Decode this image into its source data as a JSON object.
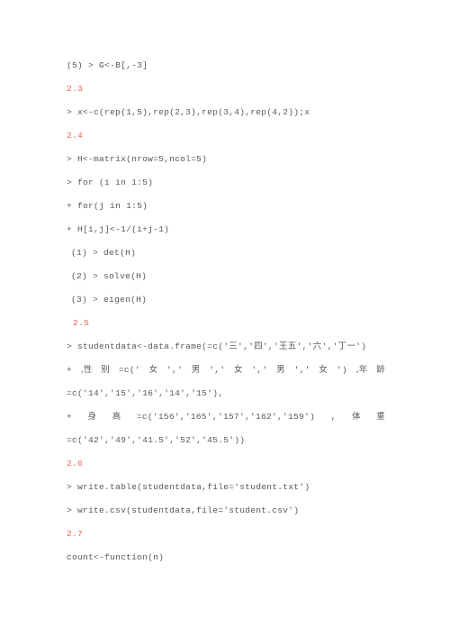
{
  "document": {
    "background_color": "#ffffff",
    "text_color": "#58585a",
    "heading_color": "#e8625a",
    "blocks": [
      {
        "kind": "code",
        "name": "line-g-assign",
        "text": "(5) > G<-B[,-3]"
      },
      {
        "kind": "heading",
        "name": "heading-2-3",
        "text": "2.3"
      },
      {
        "kind": "code",
        "name": "line-x-rep",
        "text": "> x<-c(rep(1,5),rep(2,3),rep(3,4),rep(4,2));x"
      },
      {
        "kind": "heading",
        "name": "heading-2-4",
        "text": "2.4"
      },
      {
        "kind": "code",
        "name": "line-h-matrix",
        "text": "> H<-matrix(nrow=5,ncol=5)"
      },
      {
        "kind": "code",
        "name": "line-for-i",
        "text": "> for (i in 1:5)"
      },
      {
        "kind": "code",
        "name": "line-for-j",
        "text": "+ for(j in 1:5)"
      },
      {
        "kind": "code",
        "name": "line-h-assign",
        "text": "+ H[i,j]<-1/(i+j-1)"
      },
      {
        "kind": "code",
        "name": "line-det",
        "indent": "sm",
        "text": "(1) > det(H)"
      },
      {
        "kind": "code",
        "name": "line-solve",
        "indent": "sm",
        "text": "(2) > solve(H)"
      },
      {
        "kind": "code",
        "name": "line-eigen",
        "indent": "sm",
        "text": "(3) > eigen(H)"
      },
      {
        "kind": "heading",
        "name": "heading-2-5",
        "indent": "md",
        "text": "2.5"
      },
      {
        "kind": "code",
        "name": "line-studentdata",
        "text": "> studentdata<-data.frame(=c('三','四','王五','六','丁一')"
      },
      {
        "kind": "justified",
        "name": "line-gender",
        "segments": [
          "+",
          ",性",
          "别",
          "=c('",
          "女",
          "','",
          "男",
          "','",
          "女",
          "','",
          "男",
          "','",
          "女",
          "')",
          ",年",
          "龄"
        ]
      },
      {
        "kind": "code",
        "name": "line-age-values",
        "text": "=c('14','15','16','14','15'),"
      },
      {
        "kind": "justified",
        "name": "line-height",
        "segments": [
          "+",
          "身",
          "高",
          "=c('156','165','157','162','159')",
          ",",
          "体",
          "重"
        ]
      },
      {
        "kind": "code",
        "name": "line-weight-values",
        "text": "=c('42','49','41.5','52','45.5'))"
      },
      {
        "kind": "heading",
        "name": "heading-2-6",
        "text": "2.6"
      },
      {
        "kind": "code",
        "name": "line-write-table",
        "text": "> write.table(studentdata,file='student.txt')"
      },
      {
        "kind": "code",
        "name": "line-write-csv",
        "text": "> write.csv(studentdata,file='student.csv')"
      },
      {
        "kind": "heading",
        "name": "heading-2-7",
        "text": "2.7"
      },
      {
        "kind": "code",
        "name": "line-count-function",
        "text": "count<-function(n)"
      }
    ]
  }
}
